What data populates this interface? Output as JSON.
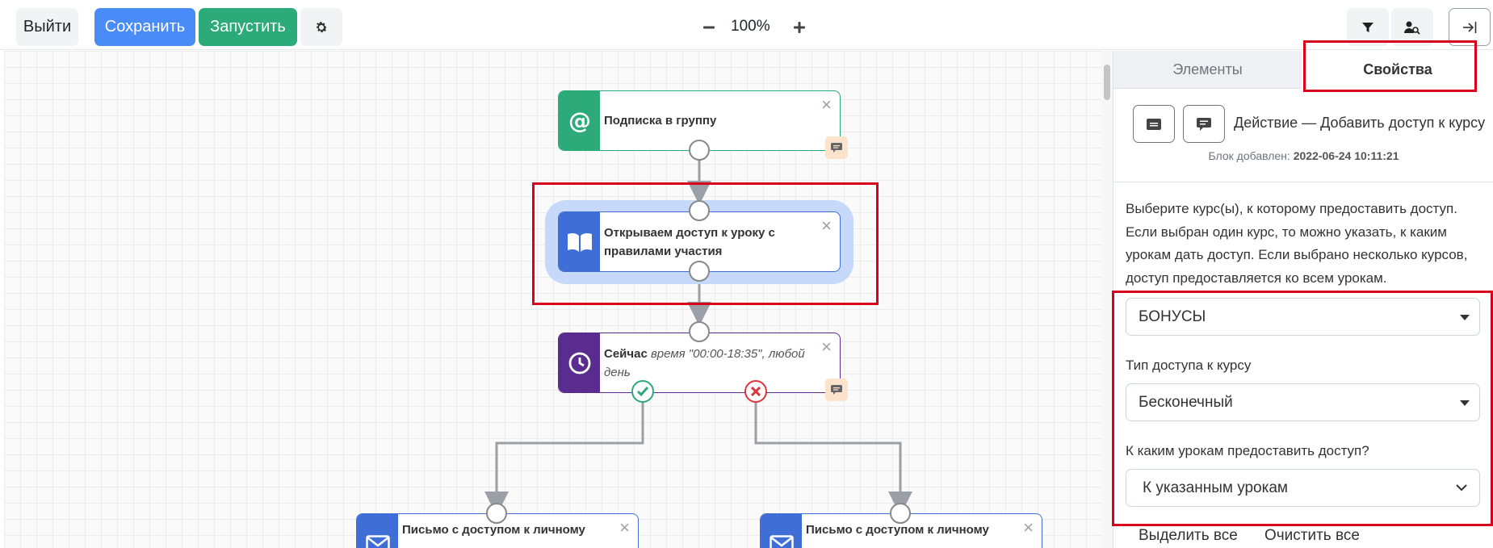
{
  "toolbar": {
    "exit_label": "Выйти",
    "save_label": "Сохранить",
    "run_label": "Запустить",
    "zoom_out_icon": "minus-icon",
    "zoom_value": "100%",
    "zoom_in_icon": "plus-icon"
  },
  "canvas": {
    "nodes": [
      {
        "title": "Подписка в группу",
        "icon": "at-icon",
        "color": "#2daa7a"
      },
      {
        "title": "Открываем доступ к уроку с правилами участия",
        "icon": "book-icon",
        "color": "#3f6fd6"
      },
      {
        "title": "Сейчас",
        "subtitle": "время \"00:00-18:35\", любой день",
        "icon": "clock-icon",
        "color": "#5b2c8f"
      },
      {
        "title": "Письмо с доступом к личному",
        "icon": "mail-icon",
        "color": "#3f6fd6"
      },
      {
        "title": "Письмо с доступом к личному",
        "icon": "mail-icon",
        "color": "#3f6fd6"
      }
    ]
  },
  "panel": {
    "tabs": [
      "Элементы",
      "Свойства"
    ],
    "action_title": "Действие — Добавить доступ к курсу",
    "block_added_label": "Блок добавлен:",
    "block_added_value": "2022-06-24 10:11:21",
    "description": "Выберите курс(ы), к которому предоставить доступ. Если выбран один курс, то можно указать, к каким урокам дать доступ. Если выбрано несколько курсов, доступ предоставляется ко всем урокам.",
    "course_value": "БОНУСЫ",
    "access_type_label": "Тип доступа к курсу",
    "access_type_value": "Бесконечный",
    "lessons_label": "К каким урокам предоставить доступ?",
    "lessons_value": "К указанным урокам",
    "select_all": "Выделить все",
    "clear_all": "Очистить все"
  }
}
